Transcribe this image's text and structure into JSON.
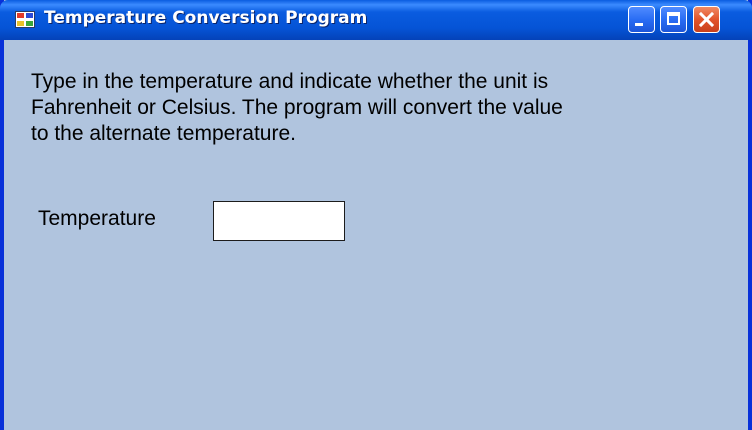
{
  "window": {
    "title": "Temperature Conversion Program",
    "icon": "application-icon",
    "controls": [
      "minimize-icon",
      "maximize-icon",
      "close-icon"
    ],
    "client_background": "#b0c4de",
    "title_bar_color": "#0554d6"
  },
  "form": {
    "instructions": "Type in the temperature and indicate whether the unit is\nFahrenheit or Celsius.  The program will convert the value\nto the alternate temperature.",
    "temperature_label": "Temperature",
    "temperature_value": ""
  }
}
